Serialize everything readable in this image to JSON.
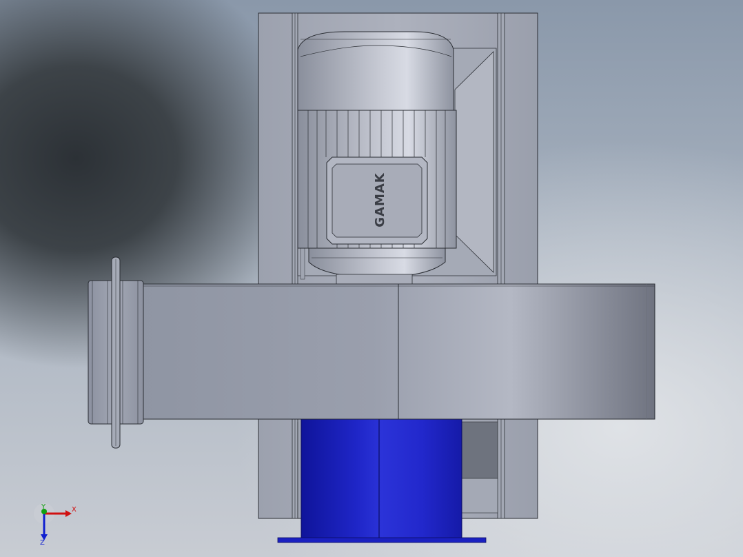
{
  "model": {
    "motor_nameplate_text": "GAMAK"
  },
  "triad": {
    "x_label": "X",
    "y_label": "Y",
    "z_label": "Z"
  },
  "colors": {
    "housing_gray": "#9aa0ad",
    "frame_gray": "#a7acb8",
    "outlet_blue": "#1c22c8",
    "outline": "#2a2d33",
    "axis_x": "#d01010",
    "axis_y": "#10a010",
    "axis_z": "#1020d0"
  }
}
